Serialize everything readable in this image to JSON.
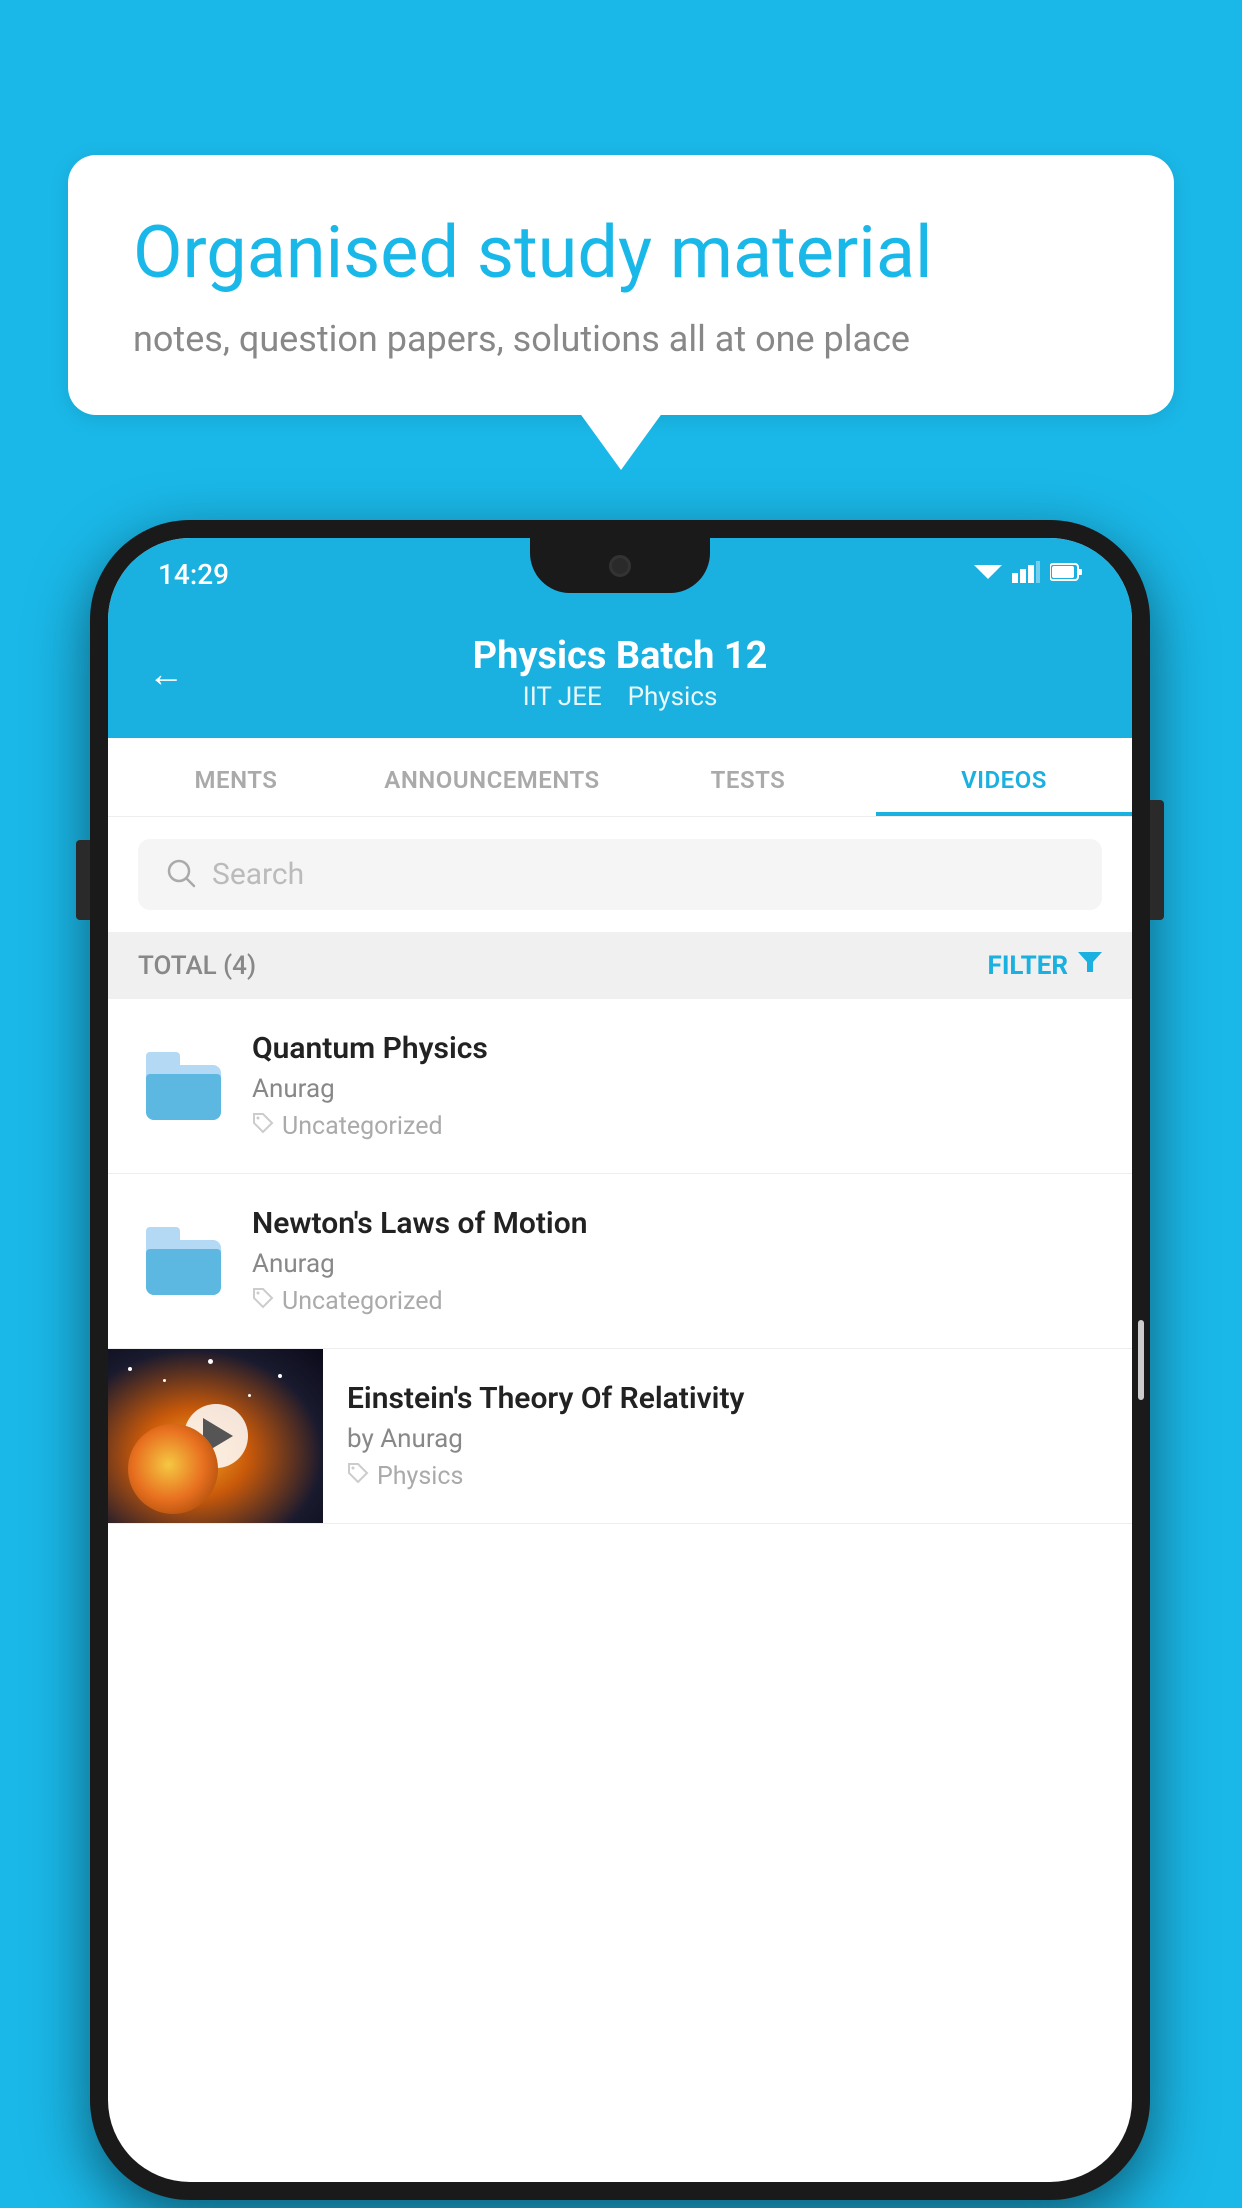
{
  "background_color": "#1ab8e8",
  "speech_bubble": {
    "title": "Organised study material",
    "subtitle": "notes, question papers, solutions all at one place"
  },
  "status_bar": {
    "time": "14:29",
    "wifi": "▼",
    "signal": "▲",
    "battery": "▐"
  },
  "app_header": {
    "back_label": "←",
    "title": "Physics Batch 12",
    "subtitle_course": "IIT JEE",
    "subtitle_subject": "Physics"
  },
  "tabs": [
    {
      "label": "MENTS",
      "active": false
    },
    {
      "label": "ANNOUNCEMENTS",
      "active": false
    },
    {
      "label": "TESTS",
      "active": false
    },
    {
      "label": "VIDEOS",
      "active": true
    }
  ],
  "search": {
    "placeholder": "Search"
  },
  "filter_bar": {
    "total_label": "TOTAL (4)",
    "filter_label": "FILTER"
  },
  "videos": [
    {
      "title": "Quantum Physics",
      "author": "Anurag",
      "tag": "Uncategorized",
      "has_thumbnail": false
    },
    {
      "title": "Newton's Laws of Motion",
      "author": "Anurag",
      "tag": "Uncategorized",
      "has_thumbnail": false
    },
    {
      "title": "Einstein's Theory Of Relativity",
      "author": "by Anurag",
      "tag": "Physics",
      "has_thumbnail": true
    }
  ]
}
